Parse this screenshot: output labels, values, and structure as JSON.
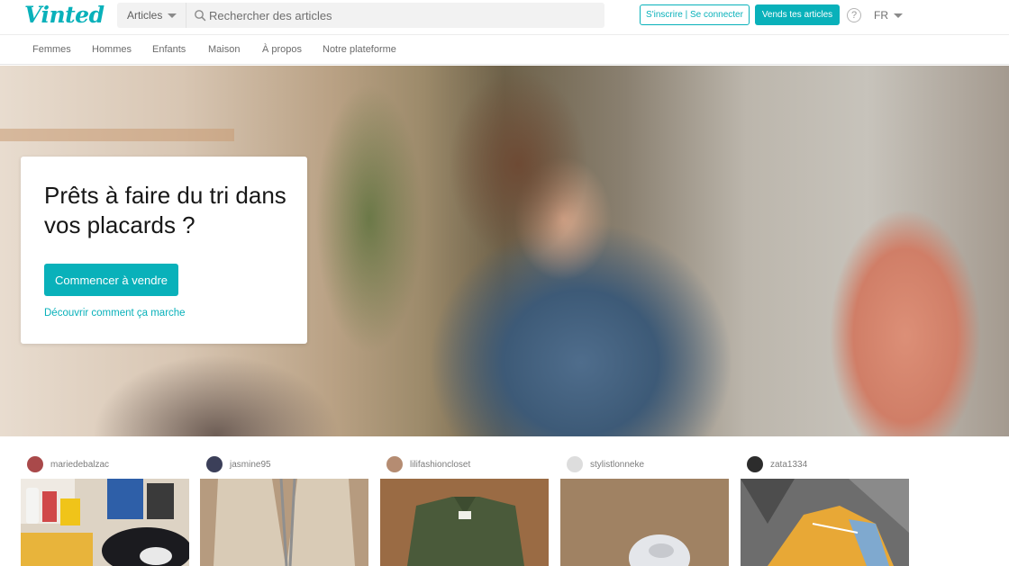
{
  "header": {
    "logo": "Vinted",
    "search_category": "Articles",
    "search_placeholder": "Rechercher des articles",
    "login_button": "S'inscrire | Se connecter",
    "sell_button": "Vends tes articles",
    "help_icon": "?",
    "language": "FR"
  },
  "nav": {
    "items": [
      "Femmes",
      "Hommes",
      "Enfants",
      "Maison",
      "À propos",
      "Notre plateforme"
    ]
  },
  "hero": {
    "title": "Prêts à faire du tri dans vos placards ?",
    "cta": "Commencer à vendre",
    "link": "Découvrir comment ça marche"
  },
  "items": [
    {
      "username": "mariedebalzac"
    },
    {
      "username": "jasmine95"
    },
    {
      "username": "lilifashioncloset"
    },
    {
      "username": "stylistlonneke"
    },
    {
      "username": "zata1334"
    }
  ],
  "colors": {
    "brand": "#09b1ba",
    "text": "#171717",
    "muted": "#6f6f6f"
  }
}
